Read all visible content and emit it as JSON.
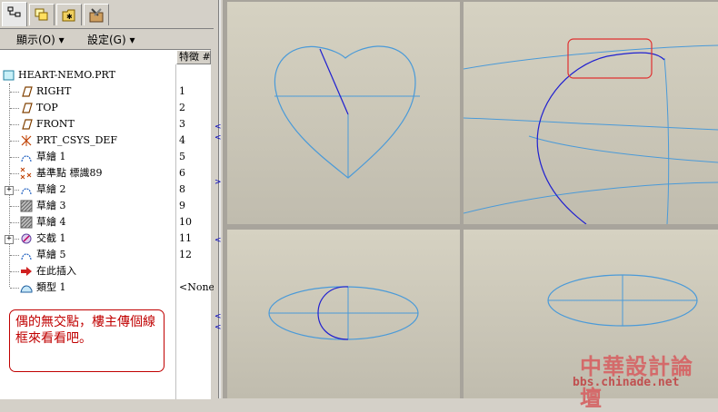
{
  "toolbar": {
    "tabs": [
      {
        "icon": "model-tree-icon"
      },
      {
        "icon": "layers-icon"
      },
      {
        "icon": "folder-icon"
      },
      {
        "icon": "tools-icon"
      }
    ],
    "show_menu": "顯示(O)",
    "settings_menu": "設定(G)"
  },
  "tree": {
    "column_header": "特徵 #",
    "root": "HEART-NEMO.PRT",
    "items": [
      {
        "label": "RIGHT",
        "num": "1",
        "icon": "datum-plane-icon"
      },
      {
        "label": "TOP",
        "num": "2",
        "icon": "datum-plane-icon"
      },
      {
        "label": "FRONT",
        "num": "3",
        "icon": "datum-plane-icon"
      },
      {
        "label": "PRT_CSYS_DEF",
        "num": "4",
        "icon": "csys-icon"
      },
      {
        "label": "草繪 1",
        "num": "5",
        "icon": "sketch-icon"
      },
      {
        "label": "基準點 標識89",
        "num": "6",
        "icon": "datum-point-icon"
      },
      {
        "label": "草繪 2",
        "num": "8",
        "icon": "sketch-icon",
        "expandable": true
      },
      {
        "label": "草繪 3",
        "num": "9",
        "icon": "sketch-hatched-icon"
      },
      {
        "label": "草繪 4",
        "num": "10",
        "icon": "sketch-hatched-icon"
      },
      {
        "label": "交截 1",
        "num": "11",
        "icon": "intersect-icon",
        "expandable": true
      },
      {
        "label": "草繪 5",
        "num": "12",
        "icon": "sketch-icon"
      },
      {
        "label": "在此插入",
        "num": "",
        "icon": "insert-here-icon"
      },
      {
        "label": "類型 1",
        "num": "<None:",
        "icon": "boundary-blend-icon"
      }
    ]
  },
  "note": {
    "text": "偶的無交點，樓主傳個線框來看看吧。"
  },
  "watermark": {
    "title": "中華設計論壇",
    "url": "bbs.chinade.net"
  },
  "colors": {
    "curve_light": "#4a9ad8",
    "curve_dark": "#2020d0",
    "highlight_box": "#e03030",
    "note_red": "#c00000"
  }
}
